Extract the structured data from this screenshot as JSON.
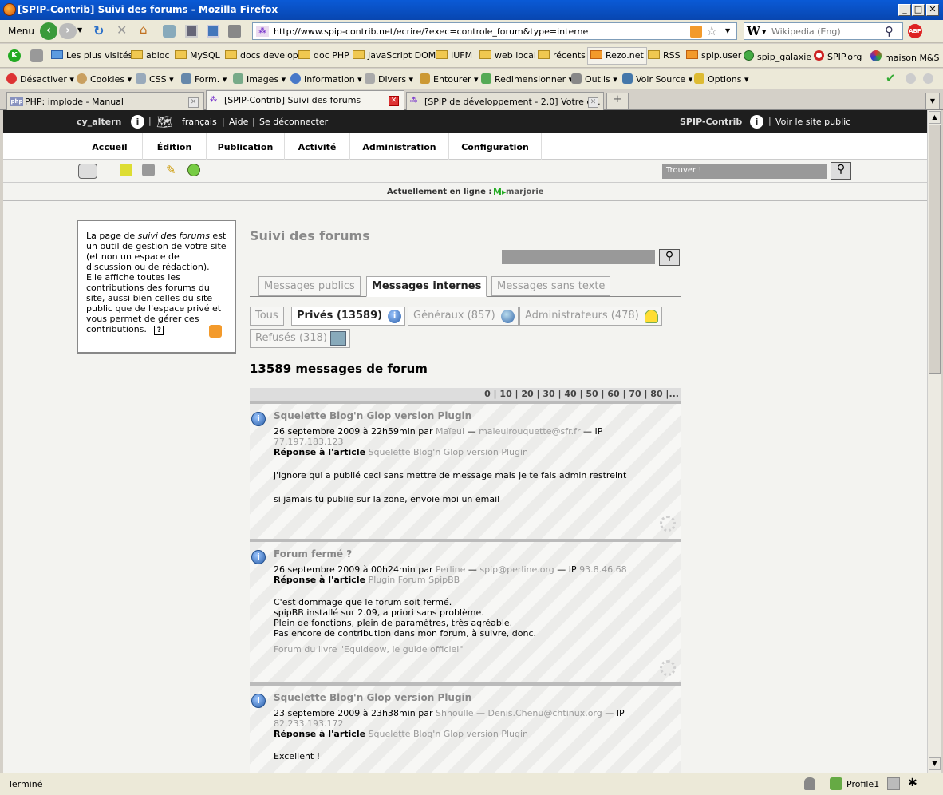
{
  "window": {
    "title": "[SPIP-Contrib] Suivi des forums - Mozilla Firefox"
  },
  "navbar": {
    "menu_label": "Menu",
    "url": "http://www.spip-contrib.net/ecrire/?exec=controle_forum&type=interne",
    "search_engine": "W",
    "search_placeholder": "Wikipedia (Eng)",
    "abp_label": "ABP"
  },
  "bookmarks": [
    "Les plus visités",
    "abloc",
    "MySQL",
    "docs develop",
    "doc PHP",
    "JavaScript DOM",
    "IUFM",
    "web local",
    "récents",
    "Rezo.net",
    "RSS",
    "spip.user",
    "spip_galaxie",
    "SPIP.org",
    "maison M&S"
  ],
  "webdev": [
    "Désactiver",
    "Cookies",
    "CSS",
    "Form.",
    "Images",
    "Information",
    "Divers",
    "Entourer",
    "Redimensionner",
    "Outils",
    "Voir Source",
    "Options"
  ],
  "tabs": [
    {
      "label": "PHP: implode - Manual",
      "favicon": "php"
    },
    {
      "label": "[SPIP-Contrib] Suivi des forums",
      "favicon": "spip"
    },
    {
      "label": "[SPIP de développement - 2.0] Votre e...",
      "favicon": "spip"
    }
  ],
  "spip": {
    "user": "cy_altern",
    "lang": "français",
    "aide": "Aide",
    "logout": "Se déconnecter",
    "site": "SPIP-Contrib",
    "view_public": "Voir le site public",
    "menu": [
      "Accueil",
      "Édition",
      "Publication",
      "Activité",
      "Administration",
      "Configuration"
    ],
    "search_placeholder": "Trouver !",
    "online_label": "Actuellement en ligne :",
    "online_user": "marjorie"
  },
  "info": {
    "text_1": "La page de ",
    "text_em": "suivi des forums",
    "text_2": " est un outil de gestion de votre site (et non un espace de discussion ou de rédaction). Elle affiche toutes les contributions des forums du site, aussi bien celles du site public que de l'espace privé et vous permet de gérer ces contributions.",
    "help_icon": "?"
  },
  "main": {
    "title": "Suivi des forums",
    "tabs": [
      "Messages publics",
      "Messages internes",
      "Messages sans texte"
    ],
    "filters": [
      "Tous",
      "Privés (13589)",
      "Généraux (857)",
      "Administrateurs (478)",
      "Refusés (318)"
    ],
    "count_heading": "13589 messages de forum",
    "pager": "0 | 10 | 20 | 30 | 40 | 50 | 60 | 70 | 80 |..."
  },
  "posts": [
    {
      "title": "Squelette Blog'n Glop version Plugin",
      "date": "26 septembre 2009 à 22h59min par",
      "author": "Maïeul",
      "email": "maieulrouquette@sfr.fr",
      "ip_label": "— IP",
      "ip": "77.197.183.123",
      "reply_label": "Réponse à l'article",
      "article": "Squelette Blog'n Glop version Plugin",
      "body1": "j'ignore qui a publié ceci sans mettre de message mais je te fais admin restreint",
      "body2": "si jamais tu publie sur la zone, envoie moi un email"
    },
    {
      "title": "Forum fermé ?",
      "date": "26 septembre 2009 à 00h24min par",
      "author": "Perline",
      "email": "spip@perline.org",
      "ip_label": "— IP",
      "ip": "93.8.46.68",
      "reply_label": "Réponse à l'article",
      "article": "Plugin Forum SpipBB",
      "body1": "C'est dommage que le forum soit fermé.",
      "body2": "spipBB installé sur 2.09, a priori sans problème.",
      "body3": "Plein de fonctions, plein de paramètres, très agréable.",
      "body4": "Pas encore de contribution dans mon forum, à suivre, donc.",
      "signature": "Forum du livre \"Equideow, le guide officiel\""
    },
    {
      "title": "Squelette Blog'n Glop version Plugin",
      "date": "23 septembre 2009 à 23h38min par",
      "author": "Shnoulle",
      "email": "Denis.Chenu@chtinux.org",
      "ip_label": "— IP",
      "ip": "82.233.193.172",
      "reply_label": "Réponse à l'article",
      "article": "Squelette Blog'n Glop version Plugin",
      "body1": "Excellent !"
    }
  ],
  "status": {
    "text": "Terminé",
    "profile": "Profile1"
  }
}
